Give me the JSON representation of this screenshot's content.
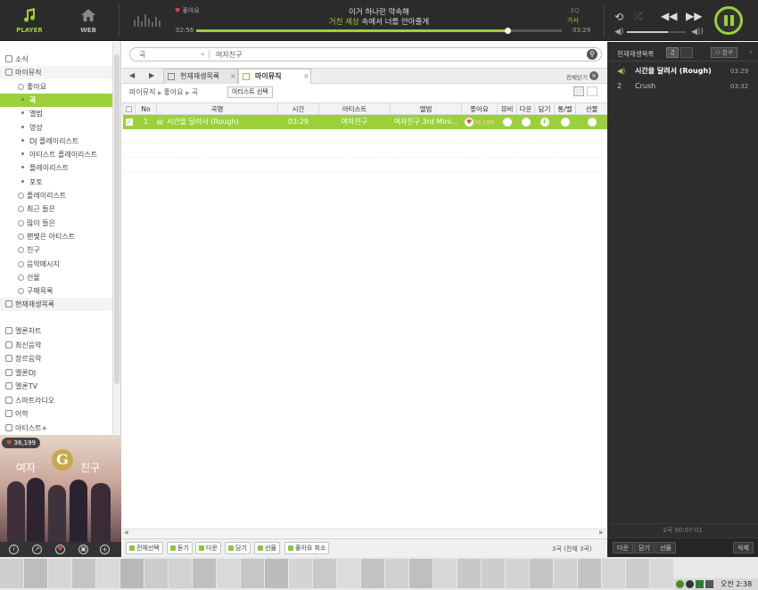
{
  "topbar": {
    "player_label": "PLAYER",
    "web_label": "WEB",
    "like_label": "좋아요",
    "lyric_line1": "이거 하나란 약속해",
    "lyric_line2_hl": "거친 세상",
    "lyric_line2_rest": " 속에서 너를 안아줄게",
    "time_current": "02:56",
    "time_total": "03:29",
    "mode_label": "EQ",
    "mode_sub": "가사",
    "progress": 0.85,
    "volume": 0.7
  },
  "left": {
    "tree": [
      {
        "label": "소식",
        "level": 0,
        "icon": "news-icon"
      },
      {
        "label": "마이뮤직",
        "level": 0,
        "icon": "mymusic-icon"
      },
      {
        "label": "좋아요",
        "level": 1,
        "icon": "collapse-icon"
      },
      {
        "label": "곡",
        "level": 2,
        "selected": true
      },
      {
        "label": "앨범",
        "level": 2
      },
      {
        "label": "영상",
        "level": 2
      },
      {
        "label": "DJ 플레이리스트",
        "level": 2
      },
      {
        "label": "아티스트 플레이리스트",
        "level": 2
      },
      {
        "label": "플레이리스트",
        "level": 2
      },
      {
        "label": "포토",
        "level": 2
      },
      {
        "label": "플레이리스트",
        "level": 1,
        "icon": "expand-icon"
      },
      {
        "label": "최근 들은",
        "level": 1,
        "icon": "expand-icon"
      },
      {
        "label": "많이 들은",
        "level": 1,
        "icon": "expand-icon"
      },
      {
        "label": "팬맺은 아티스트",
        "level": 1,
        "icon": "expand-icon"
      },
      {
        "label": "친구",
        "level": 1,
        "icon": "expand-icon"
      },
      {
        "label": "음악메시지",
        "level": 1,
        "icon": "expand-icon"
      },
      {
        "label": "선물",
        "level": 1,
        "icon": "expand-icon"
      },
      {
        "label": "구매목록",
        "level": 1,
        "icon": "expand-icon"
      }
    ],
    "nowplaying_label": "현재재생목록",
    "menu": [
      {
        "label": "멜론차트",
        "icon": "chart-icon"
      },
      {
        "label": "최신음악",
        "icon": "new-music-icon"
      },
      {
        "label": "장르음악",
        "icon": "genre-icon"
      },
      {
        "label": "멜론DJ",
        "icon": "dj-icon"
      },
      {
        "label": "멜론TV",
        "icon": "tv-icon"
      },
      {
        "label": "스마트라디오",
        "icon": "radio-icon"
      },
      {
        "label": "어학",
        "icon": "language-icon"
      },
      {
        "label": "아티스트+",
        "icon": "artist-plus-icon"
      }
    ],
    "album_like_count": "36,199",
    "album_text_left": "여자",
    "album_text_center": "G",
    "album_text_right": "친구"
  },
  "center": {
    "search_category": "곡",
    "search_value": "여자친구",
    "tabs": [
      {
        "label": "현재재생목록"
      },
      {
        "label": "마이뮤직"
      }
    ],
    "close_all_label": "전체닫기",
    "breadcrumb": [
      "마이뮤직",
      "좋아요",
      "곡"
    ],
    "artist_select_label": "아티스트 선택",
    "columns": [
      "No",
      "곡명",
      "시간",
      "아티스트",
      "앨범",
      "좋아요",
      "뮤비",
      "다운",
      "담기",
      "통/벨",
      "선물"
    ],
    "rows": [
      {
        "no": "1",
        "title": "시간을 달려서 (Rough)",
        "time": "03:29",
        "artist": "여자친구",
        "album": "여자친구 3rd Mini...",
        "likes": "36,199"
      }
    ]
  },
  "bottombar": {
    "buttons": [
      "전체선택",
      "듣기",
      "다운",
      "담기",
      "선물",
      "좋아요 취소"
    ],
    "summary": "3곡 (전체 3곡)"
  },
  "right": {
    "header_label": "현재재생목록",
    "friend_label": "친구",
    "playlist": [
      {
        "no": "1",
        "title": "시간을 달려서 (Rough)",
        "time": "03:29",
        "playing": true
      },
      {
        "no": "2",
        "title": "Crush",
        "time": "03:32",
        "playing": false
      }
    ],
    "total": "2곡 00:07:01",
    "buttons": [
      "다운",
      "담기",
      "선물"
    ],
    "delete_label": "삭제"
  },
  "taskbar": {
    "clock": "오전 2:38"
  },
  "colors": {
    "accent": "#9bd03b",
    "dark": "#2b2b2b"
  }
}
